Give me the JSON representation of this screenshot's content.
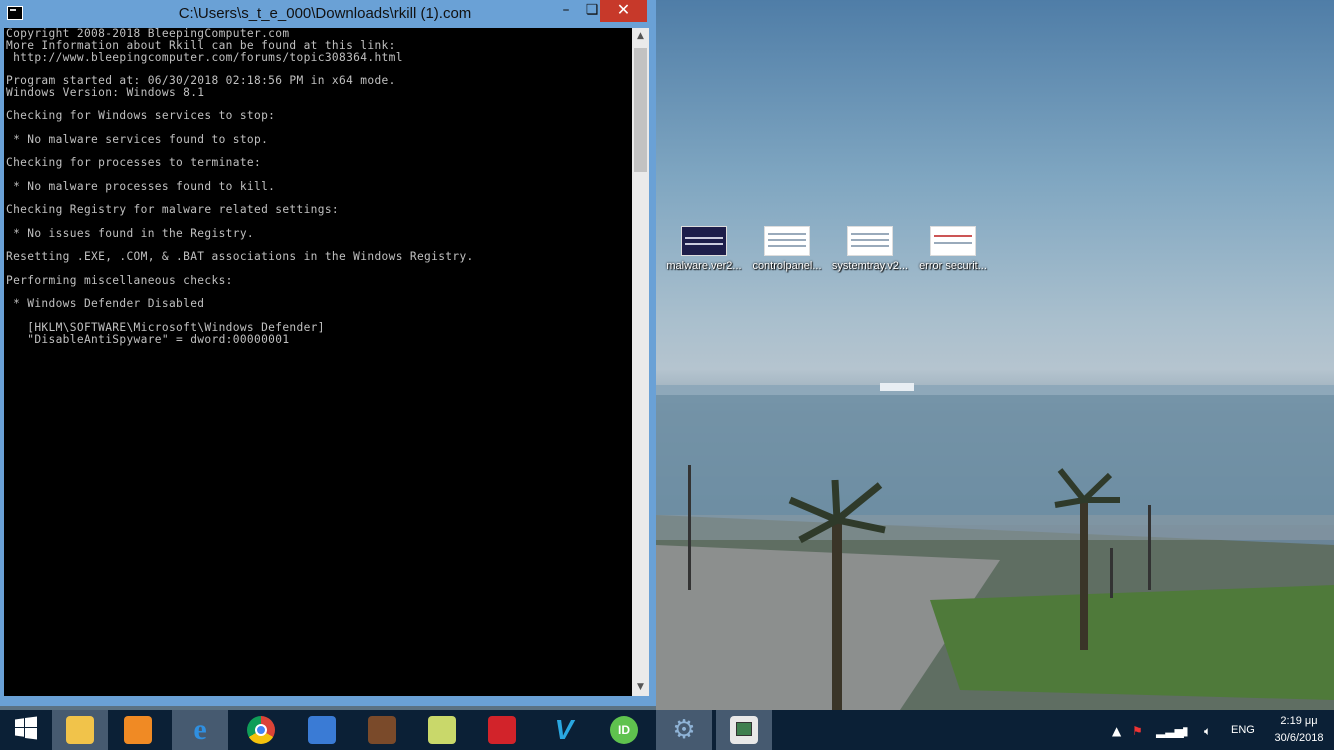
{
  "window": {
    "title": "C:\\Users\\s_t_e_000\\Downloads\\rkill (1).com",
    "minimize_glyph": "–",
    "maximize_glyph": "❏",
    "close_glyph": "✕"
  },
  "console": {
    "lines": [
      "Copyright 2008-2018 BleepingComputer.com",
      "More Information about Rkill can be found at this link:",
      " http://www.bleepingcomputer.com/forums/topic308364.html",
      "",
      "Program started at: 06/30/2018 02:18:56 PM in x64 mode.",
      "Windows Version: Windows 8.1",
      "",
      "Checking for Windows services to stop:",
      "",
      " * No malware services found to stop.",
      "",
      "Checking for processes to terminate:",
      "",
      " * No malware processes found to kill.",
      "",
      "Checking Registry for malware related settings:",
      "",
      " * No issues found in the Registry.",
      "",
      "Resetting .EXE, .COM, & .BAT associations in the Windows Registry.",
      "",
      "Performing miscellaneous checks:",
      "",
      " * Windows Defender Disabled",
      "",
      "   [HKLM\\SOFTWARE\\Microsoft\\Windows Defender]",
      "   \"DisableAntiSpyware\" = dword:00000001"
    ]
  },
  "desktop_icons": [
    {
      "label": "malware.ver2...",
      "icon": "screenshot-thumbnail-icon"
    },
    {
      "label": "controlpanel...",
      "icon": "screenshot-thumbnail-icon"
    },
    {
      "label": "systemtray.v2...",
      "icon": "screenshot-thumbnail-icon"
    },
    {
      "label": "error securit...",
      "icon": "screenshot-thumbnail-icon"
    }
  ],
  "taskbar": {
    "apps": [
      {
        "name": "start-button",
        "icon": "windows-logo-icon",
        "color": "#ffffff"
      },
      {
        "name": "file-explorer",
        "icon": "folder-icon",
        "color": "#f1c34a"
      },
      {
        "name": "media-player",
        "icon": "play-icon",
        "color": "#f08a24"
      },
      {
        "name": "internet-explorer",
        "icon": "ie-icon",
        "color": "#2f8fe0"
      },
      {
        "name": "chrome",
        "icon": "chrome-icon",
        "color": "#db4437"
      },
      {
        "name": "thunderbird",
        "icon": "mail-bird-icon",
        "color": "#3a7bd5"
      },
      {
        "name": "game-app",
        "icon": "game-icon",
        "color": "#7a4a2a"
      },
      {
        "name": "xsplit-app",
        "icon": "diamond-icon",
        "color": "#c9d86a"
      },
      {
        "name": "remote-app",
        "icon": "red-monster-icon",
        "color": "#d2232a"
      },
      {
        "name": "vpn-app",
        "icon": "v-logo-icon",
        "color": "#2aa7e0"
      },
      {
        "name": "downloader-app",
        "icon": "idm-icon",
        "color": "#5fc24e"
      },
      {
        "name": "settings-app",
        "icon": "gear-icon",
        "color": "#8fb3d6"
      },
      {
        "name": "console-app",
        "icon": "window-icon",
        "color": "#e8e8e8"
      }
    ],
    "tray": {
      "language": "ENG",
      "time": "2:19 μμ",
      "date": "30/6/2018"
    }
  }
}
